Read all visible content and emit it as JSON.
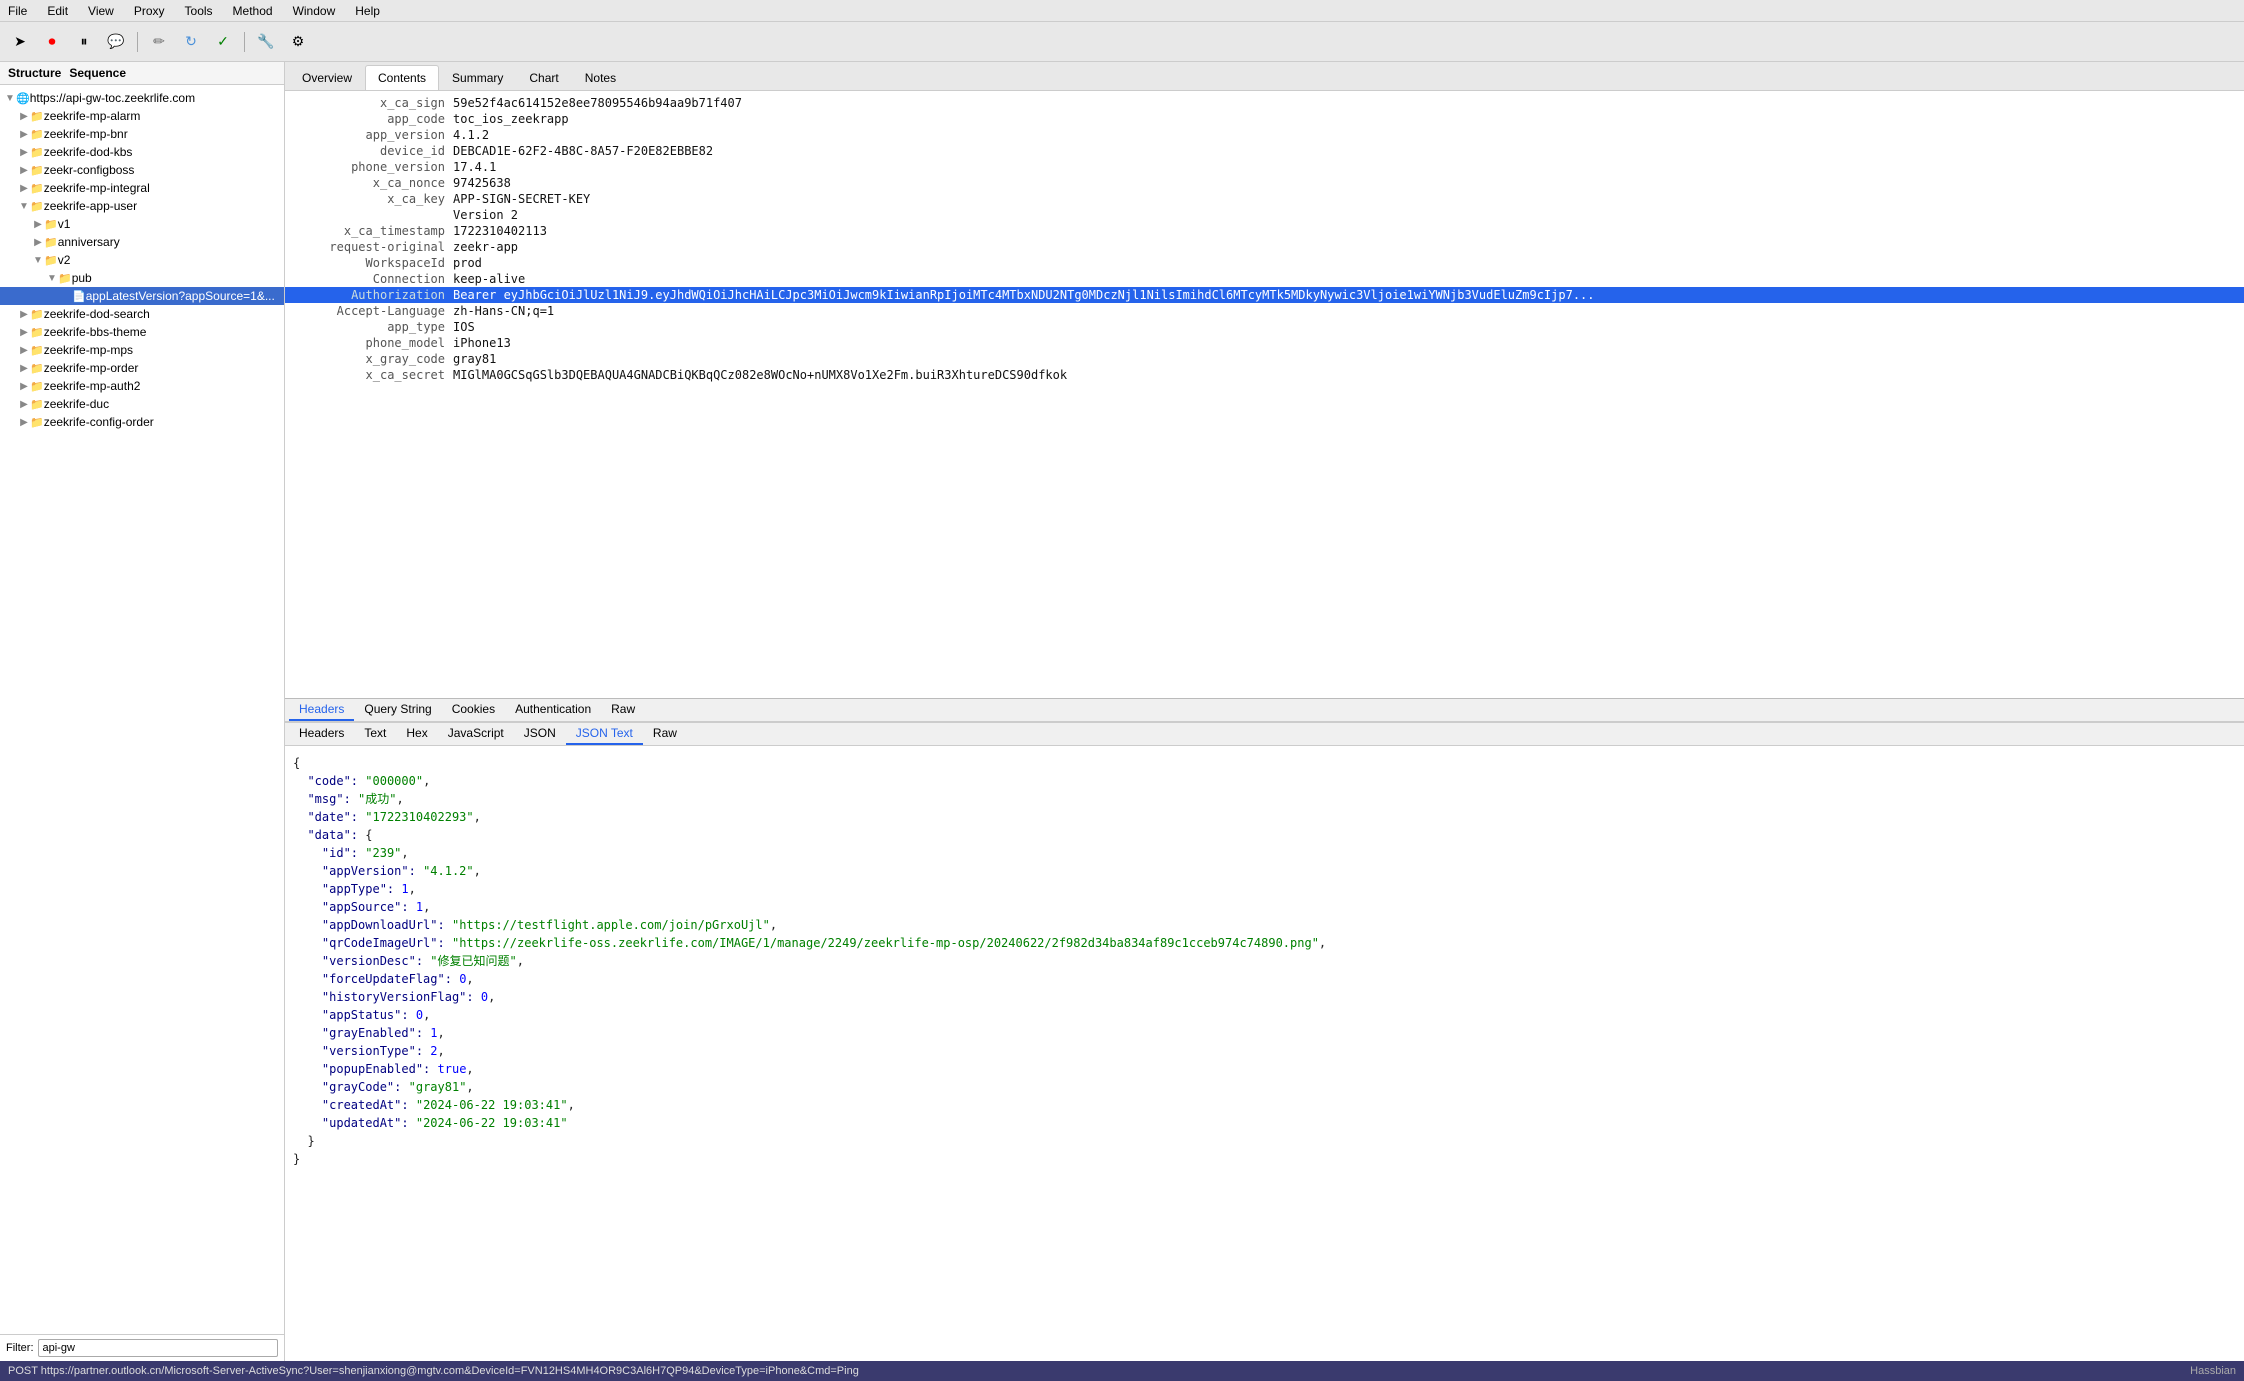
{
  "menubar": {
    "items": [
      "File",
      "Edit",
      "View",
      "Proxy",
      "Tools",
      "Method",
      "Window",
      "Help"
    ]
  },
  "toolbar": {
    "buttons": [
      "arrow-left",
      "record-stop",
      "pause",
      "intercept",
      "edit-pencil",
      "refresh",
      "check",
      "tools",
      "settings"
    ]
  },
  "sidebar": {
    "header": {
      "structure_label": "Structure",
      "sequence_label": "Sequence"
    },
    "tree": [
      {
        "id": "root",
        "label": "https://api-gw-toc.zeekrlife.com",
        "level": 0,
        "expand": "open",
        "type": "host"
      },
      {
        "id": "1",
        "label": "zeekrife-mp-alarm",
        "level": 1,
        "expand": "closed",
        "type": "folder"
      },
      {
        "id": "2",
        "label": "zeekrife-mp-bnr",
        "level": 1,
        "expand": "closed",
        "type": "folder"
      },
      {
        "id": "3",
        "label": "zeekrife-dod-kbs",
        "level": 1,
        "expand": "closed",
        "type": "folder"
      },
      {
        "id": "4",
        "label": "zeekr-configboss",
        "level": 1,
        "expand": "closed",
        "type": "folder"
      },
      {
        "id": "5",
        "label": "zeekrife-mp-integral",
        "level": 1,
        "expand": "closed",
        "type": "folder"
      },
      {
        "id": "6",
        "label": "zeekrife-app-user",
        "level": 1,
        "expand": "open",
        "type": "folder"
      },
      {
        "id": "6a",
        "label": "v1",
        "level": 2,
        "expand": "closed",
        "type": "folder"
      },
      {
        "id": "6b",
        "label": "anniversary",
        "level": 2,
        "expand": "closed",
        "type": "folder"
      },
      {
        "id": "6c",
        "label": "v2",
        "level": 2,
        "expand": "open",
        "type": "folder"
      },
      {
        "id": "6c1",
        "label": "pub",
        "level": 3,
        "expand": "open",
        "type": "folder"
      },
      {
        "id": "6c1a",
        "label": "appLatestVersion?appSource=1&...",
        "level": 4,
        "expand": "none",
        "type": "request",
        "selected": true
      },
      {
        "id": "7",
        "label": "zeekrife-dod-search",
        "level": 1,
        "expand": "closed",
        "type": "folder"
      },
      {
        "id": "8",
        "label": "zeekrife-bbs-theme",
        "level": 1,
        "expand": "closed",
        "type": "folder"
      },
      {
        "id": "9",
        "label": "zeekrife-mp-mps",
        "level": 1,
        "expand": "closed",
        "type": "folder"
      },
      {
        "id": "10",
        "label": "zeekrife-mp-order",
        "level": 1,
        "expand": "closed",
        "type": "folder"
      },
      {
        "id": "11",
        "label": "zeekrife-mp-auth2",
        "level": 1,
        "expand": "closed",
        "type": "folder"
      },
      {
        "id": "12",
        "label": "zeekrife-duc",
        "level": 1,
        "expand": "closed",
        "type": "folder"
      },
      {
        "id": "13",
        "label": "zeekrife-config-order",
        "level": 1,
        "expand": "closed",
        "type": "folder"
      }
    ],
    "filter": {
      "label": "Filter:",
      "value": "api-gw"
    }
  },
  "content": {
    "tabs": [
      "Overview",
      "Contents",
      "Summary",
      "Chart",
      "Notes"
    ],
    "active_tab": "Contents",
    "request_headers": [
      {
        "key": "x_ca_sign",
        "value": "59e52f4ac614152e8ee78095546b94aa9b71f407"
      },
      {
        "key": "app_code",
        "value": "toc_ios_zeekrapp"
      },
      {
        "key": "app_version",
        "value": "4.1.2"
      },
      {
        "key": "device_id",
        "value": "DEBCAD1E-62F2-4B8C-8A57-F20E82EBBE82"
      },
      {
        "key": "phone_version",
        "value": "17.4.1"
      },
      {
        "key": "x_ca_nonce",
        "value": "97425638"
      },
      {
        "key": "x_ca_key",
        "value": "APP-SIGN-SECRET-KEY"
      },
      {
        "key": "",
        "value": "Version 2"
      },
      {
        "key": "x_ca_timestamp",
        "value": "1722310402113"
      },
      {
        "key": "request-original",
        "value": "zeekr-app"
      },
      {
        "key": "WorkspaceId",
        "value": "prod"
      },
      {
        "key": "Connection",
        "value": "keep-alive"
      },
      {
        "key": "Authorization",
        "value": "Bearer eyJhbGciOiJlUzl1NiJ9.eyJhdWQiOiJhcHAiLCJpc3MiOiJwcm9kIiwianRpIjoiMTc4MTbxNDU2NTg0MDczNjl1NilsImihdCl6MTcyMTk5MDkyNywic3Vljoie1wiYWNjb3VudEluZm9cIjp7...",
        "highlighted": true
      },
      {
        "key": "Accept-Language",
        "value": "zh-Hans-CN;q=1"
      },
      {
        "key": "app_type",
        "value": "IOS"
      },
      {
        "key": "phone_model",
        "value": "iPhone13"
      },
      {
        "key": "x_gray_code",
        "value": "gray81"
      },
      {
        "key": "x_ca_secret",
        "value": "MIGlMA0GCSqGSlb3DQEBAQUA4GNADCBiQKBqQCz082e8WOcNo+nUMX8Vo1Xe2Fm.buiR3XhtureDCS90dfkok"
      }
    ],
    "sub_tabs": [
      "Headers",
      "Query String",
      "Cookies",
      "Authentication",
      "Raw"
    ],
    "active_sub_tab": "Headers",
    "response_sub_tabs": [
      "Headers",
      "Text",
      "Hex",
      "JavaScript",
      "JSON",
      "JSON Text",
      "Raw"
    ],
    "active_resp_sub_tab": "JSON Text",
    "response_json": "{\n  \"code\": \"000000\",\n  \"msg\": \"成功\",\n  \"date\": \"1722310402293\",\n  \"data\": {\n    \"id\": \"239\",\n    \"appVersion\": \"4.1.2\",\n    \"appType\": 1,\n    \"appSource\": 1,\n    \"appDownloadUrl\": \"https://testflight.apple.com/join/pGrxoUjl\",\n    \"qrCodeImageUrl\": \"https://zeekrlife-oss.zeekrlife.com/IMAGE/1/manage/2249/zeekrlife-mp-osp/20240622/2f982d34ba834af89c1cceb974c74890.png\",\n    \"versionDesc\": \"修复已知问题\",\n    \"forceUpdateFlag\": 0,\n    \"historyVersionFlag\": 0,\n    \"appStatus\": 0,\n    \"grayEnabled\": 1,\n    \"versionType\": 2,\n    \"popupEnabled\": true,\n    \"grayCode\": \"gray81\",\n    \"createdAt\": \"2024-06-22 19:03:41\",\n    \"updatedAt\": \"2024-06-22 19:03:41\"\n  }\n}"
  },
  "statusbar": {
    "url": "POST https://partner.outlook.cn/Microsoft-Server-ActiveSync?User=shenjianxiong@mgtv.com&DeviceId=FVN12HS4MH4OR9C3Al6H7QP94&DeviceType=iPhone&Cmd=Ping",
    "brand": "Hassbian"
  }
}
